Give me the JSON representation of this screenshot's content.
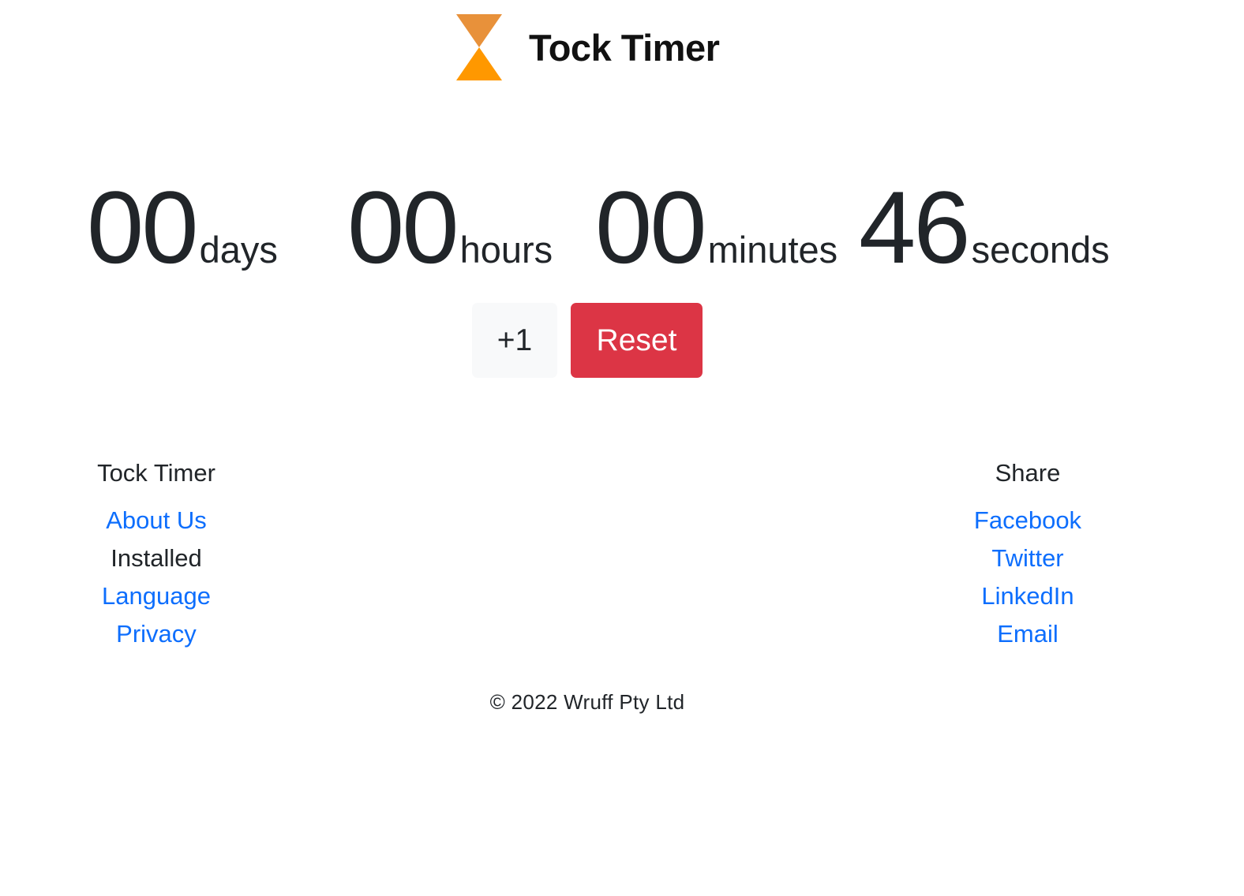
{
  "header": {
    "logo_icon": "hourglass-icon",
    "logo_colors": {
      "top": "#E8913A",
      "bottom": "#FF9800"
    },
    "title": "Tock Timer"
  },
  "countdown": {
    "days": {
      "value": "00",
      "label": "days"
    },
    "hours": {
      "value": "00",
      "label": "hours"
    },
    "minutes": {
      "value": "00",
      "label": "minutes"
    },
    "seconds": {
      "value": "46",
      "label": "seconds"
    }
  },
  "controls": {
    "plus_label": "+1",
    "reset_label": "Reset",
    "reset_color": "#dc3545"
  },
  "footer": {
    "left": {
      "heading": "Tock Timer",
      "items": [
        {
          "label": "About Us"
        },
        {
          "label": "Installed"
        },
        {
          "label": "Language"
        },
        {
          "label": "Privacy"
        }
      ]
    },
    "right": {
      "heading": "Share",
      "items": [
        {
          "label": "Facebook"
        },
        {
          "label": "Twitter"
        },
        {
          "label": "LinkedIn"
        },
        {
          "label": "Email"
        }
      ]
    },
    "link_color": "#0d6efd",
    "copyright": "© 2022 Wruff Pty Ltd"
  }
}
